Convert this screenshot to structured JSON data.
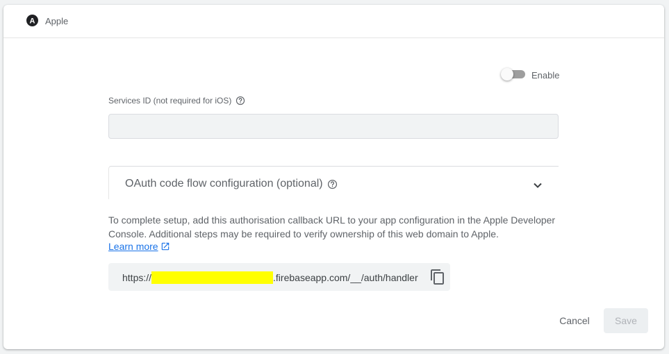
{
  "provider": {
    "name": "Apple",
    "logo_letter": "A"
  },
  "toggle": {
    "label": "Enable",
    "state": "off"
  },
  "services_id": {
    "label": "Services ID (not required for iOS)",
    "value": "",
    "placeholder": ""
  },
  "oauth": {
    "title": "OAuth code flow configuration (optional)",
    "expanded": false
  },
  "setup": {
    "line1": "To complete setup, add this authorisation callback URL to your app configuration in the Apple Developer",
    "line2": "Console. Additional steps may be required to verify ownership of this web domain to Apple.",
    "learn_more": "Learn more"
  },
  "callback_url": {
    "prefix": "https://",
    "suffix": ".firebaseapp.com/__/auth/handler",
    "redaction_color": "#ffff00"
  },
  "actions": {
    "cancel": "Cancel",
    "save": "Save"
  },
  "colors": {
    "accent": "#1a73e8",
    "text_secondary": "#5f6368"
  }
}
